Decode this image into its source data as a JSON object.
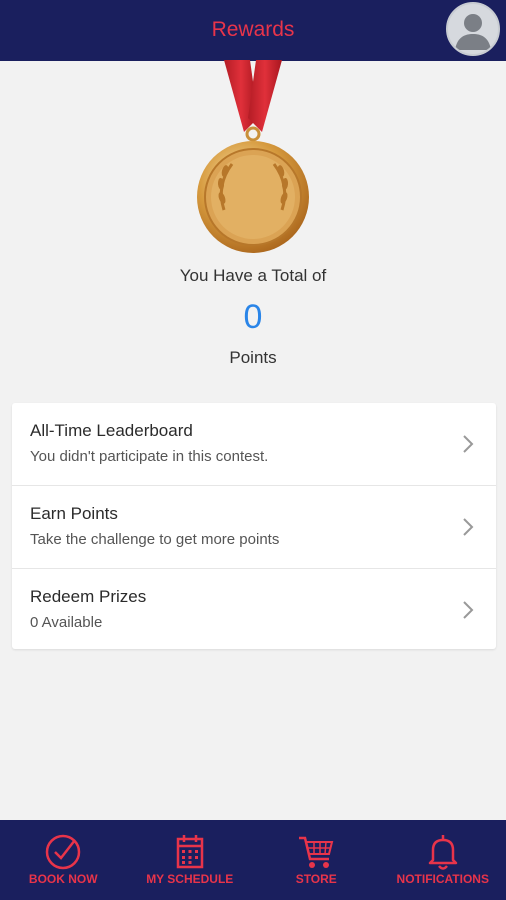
{
  "header": {
    "title": "Rewards",
    "avatar_icon": "user-avatar-icon"
  },
  "summary": {
    "total_label": "You Have a Total of",
    "points": "0",
    "points_label": "Points"
  },
  "menu": [
    {
      "title": "All-Time Leaderboard",
      "subtitle": "You didn't participate in this contest."
    },
    {
      "title": "Earn Points",
      "subtitle": "Take the challenge to get more points"
    },
    {
      "title": "Redeem Prizes",
      "subtitle": "0 Available"
    }
  ],
  "nav": [
    {
      "label": "BOOK NOW",
      "icon": "check-circle-icon"
    },
    {
      "label": "MY SCHEDULE",
      "icon": "calendar-icon"
    },
    {
      "label": "STORE",
      "icon": "cart-icon"
    },
    {
      "label": "NOTIFICATIONS",
      "icon": "bell-icon"
    }
  ],
  "colors": {
    "header_bg": "#1a1f5e",
    "accent": "#e8344a",
    "points": "#2a85e8"
  }
}
